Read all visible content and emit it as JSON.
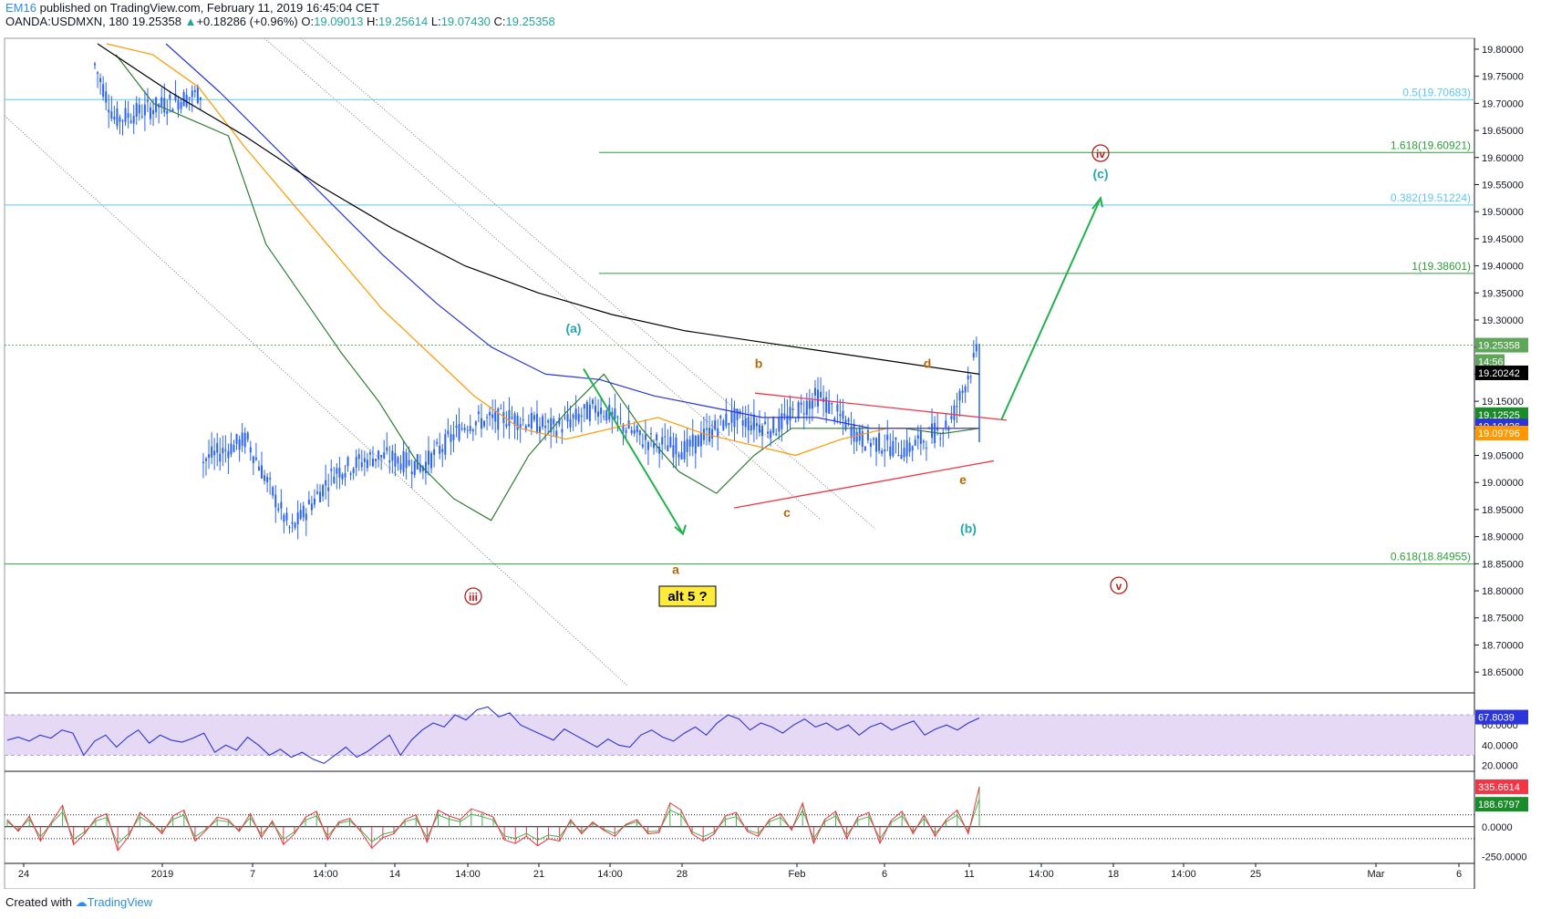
{
  "header": {
    "author": "EM16",
    "published": "published on TradingView.com, February 11, 2019 16:45:04 CET",
    "symbol": "OANDA:USDMXN, 180",
    "last": "19.25358",
    "change": "+0.18286 (+0.96%)",
    "o_label": "O:",
    "o_value": "19.09013",
    "h_label": "H:",
    "h_value": "19.25614",
    "l_label": "L:",
    "l_value": "19.07430",
    "c_label": "C:",
    "c_value": "19.25358"
  },
  "footer": {
    "created_with": "Created with",
    "brand": "TradingView"
  },
  "colors": {
    "up_candle": "#2962ff",
    "ema_fast": "#2e7d32",
    "ema_mid": "#ff9800",
    "ema_slow": "#2b35d8",
    "ema_long": "#000000",
    "fib_blue": "#5ec6f5",
    "fib_green": "#2e9e3a",
    "triangle": "#f23645",
    "wave_teal": "#26a6b0",
    "wave_brown": "#b8690a",
    "wave_red": "#b71c1c",
    "rsi_line": "#2b35d8",
    "rsi_band": "#e6d9f5"
  },
  "chart_data": [
    {
      "type": "candlestick",
      "title": "OANDA:USDMXN, 180",
      "ylim": [
        18.625,
        19.81
      ],
      "y_ticks": [
        "19.80000",
        "19.75000",
        "19.70000",
        "19.65000",
        "19.60000",
        "19.55000",
        "19.50000",
        "19.45000",
        "19.40000",
        "19.35000",
        "19.30000",
        "19.25000",
        "19.20000",
        "19.15000",
        "19.10000",
        "19.05000",
        "19.00000",
        "18.95000",
        "18.90000",
        "18.85000",
        "18.80000",
        "18.75000",
        "18.70000",
        "18.65000"
      ],
      "x_ticks": [
        "24",
        "2019",
        "7",
        "14:00",
        "14",
        "14:00",
        "21",
        "14:00",
        "28",
        "Feb",
        "6",
        "11",
        "14:00",
        "18",
        "14:00",
        "25",
        "Mar",
        "6"
      ],
      "price_path": [
        {
          "x": "Dec 27 12:00",
          "y": 19.78
        },
        {
          "x": "Dec 28",
          "y": 19.67
        },
        {
          "x": "Dec 30",
          "y": 19.72
        },
        {
          "x": "Jan 2",
          "y": 19.65
        },
        {
          "x": "Jan 4",
          "y": 19.63
        },
        {
          "x": "Jan 7",
          "y": 19.62
        },
        {
          "x": "Jan 8",
          "y": 19.47
        },
        {
          "x": "Jan 9",
          "y": 19.4
        },
        {
          "x": "Jan 10",
          "y": 19.33
        },
        {
          "x": "Jan 11",
          "y": 19.23
        },
        {
          "x": "Jan 12",
          "y": 19.2
        },
        {
          "x": "Jan 13",
          "y": 19.12
        },
        {
          "x": "Jan 14",
          "y": 19.02
        },
        {
          "x": "Jan 15",
          "y": 19.0
        },
        {
          "x": "Jan 16",
          "y": 18.9
        },
        {
          "x": "Jan 17",
          "y": 19.05
        },
        {
          "x": "Jan 18",
          "y": 19.0
        },
        {
          "x": "Jan 19",
          "y": 19.1
        },
        {
          "x": "Jan 21",
          "y": 19.17
        },
        {
          "x": "Jan 22",
          "y": 19.23
        },
        {
          "x": "Jan 23",
          "y": 19.17
        },
        {
          "x": "Jan 24",
          "y": 19.1
        },
        {
          "x": "Jan 25",
          "y": 19.04
        },
        {
          "x": "Jan 26",
          "y": 19.08
        },
        {
          "x": "Jan 27",
          "y": 18.91
        },
        {
          "x": "Jan 28",
          "y": 19.02
        },
        {
          "x": "Jan 29",
          "y": 19.05
        },
        {
          "x": "Jan 30",
          "y": 19.03
        },
        {
          "x": "Jan 31",
          "y": 19.11
        },
        {
          "x": "Feb 1",
          "y": 19.12
        },
        {
          "x": "Feb 2",
          "y": 19.1
        },
        {
          "x": "Feb 3",
          "y": 19.14
        },
        {
          "x": "Feb 4",
          "y": 19.08
        },
        {
          "x": "Feb 5",
          "y": 19.06
        },
        {
          "x": "Feb 6",
          "y": 19.12
        },
        {
          "x": "Feb 7",
          "y": 19.1
        },
        {
          "x": "Feb 8",
          "y": 19.16
        },
        {
          "x": "Feb 9",
          "y": 19.08
        },
        {
          "x": "Feb 10",
          "y": 19.06
        },
        {
          "x": "Feb 11",
          "y": 19.11
        },
        {
          "x": "Feb 11 16:00",
          "y": 19.25
        }
      ],
      "series": [
        {
          "name": "EMA fast",
          "values": [
            19.79,
            19.7,
            19.67,
            19.64,
            19.44,
            19.34,
            19.24,
            19.15,
            19.04,
            18.97,
            18.93,
            19.05,
            19.13,
            19.2,
            19.1,
            19.02,
            18.98,
            19.05,
            19.1,
            19.1,
            19.1,
            19.1,
            19.09,
            19.1
          ]
        },
        {
          "name": "EMA mid",
          "values": [
            19.81,
            19.79,
            19.73,
            19.62,
            19.52,
            19.42,
            19.32,
            19.24,
            19.16,
            19.1,
            19.08,
            19.1,
            19.12,
            19.09,
            19.07,
            19.05,
            19.08,
            19.1,
            19.1,
            19.1
          ]
        },
        {
          "name": "EMA slow",
          "values": [
            19.81,
            19.72,
            19.62,
            19.52,
            19.42,
            19.33,
            19.25,
            19.2,
            19.19,
            19.16,
            19.14,
            19.12,
            19.12,
            19.1,
            19.1,
            19.1
          ]
        },
        {
          "name": "EMA long",
          "values": [
            19.81,
            19.72,
            19.64,
            19.55,
            19.47,
            19.4,
            19.35,
            19.31,
            19.28,
            19.26,
            19.24,
            19.22,
            19.2
          ]
        }
      ],
      "price_labels": [
        {
          "value": "19.25358",
          "color": "#5fa55a"
        },
        {
          "value": "14:56",
          "color": "#5fa55a"
        },
        {
          "value": "19.20242",
          "color": "#000000"
        },
        {
          "value": "19.12525",
          "color": "#1b8a2a"
        },
        {
          "value": "19.10426",
          "color": "#2b35d8"
        },
        {
          "value": "19.09796",
          "color": "#ff9800"
        }
      ],
      "fib_levels": [
        {
          "label": "0.5(19.70683)",
          "value": 19.70683,
          "color": "blue"
        },
        {
          "label": "1.618(19.60921)",
          "value": 19.60921,
          "color": "green"
        },
        {
          "label": "0.382(19.51224)",
          "value": 19.51224,
          "color": "blue"
        },
        {
          "label": "1(19.38601)",
          "value": 19.38601,
          "color": "green"
        },
        {
          "label": "0.618(18.84955)",
          "value": 18.84955,
          "color": "green"
        }
      ],
      "wave_labels": [
        {
          "text": "iii",
          "circled": true,
          "color": "red"
        },
        {
          "text": "(a)",
          "color": "teal"
        },
        {
          "text": "a",
          "color": "brown"
        },
        {
          "text": "b",
          "color": "brown"
        },
        {
          "text": "c",
          "color": "brown"
        },
        {
          "text": "d",
          "color": "brown"
        },
        {
          "text": "e",
          "color": "brown"
        },
        {
          "text": "(b)",
          "color": "teal"
        },
        {
          "text": "(c)",
          "color": "teal"
        },
        {
          "text": "iv",
          "circled": true,
          "color": "red"
        },
        {
          "text": "v",
          "circled": true,
          "color": "red"
        }
      ],
      "annotation": "alt 5 ?"
    },
    {
      "type": "line",
      "name": "RSI",
      "ylim": [
        15,
        90
      ],
      "band": [
        70,
        30
      ],
      "y_ticks": [
        "60.0000",
        "40.0000",
        "20.0000"
      ],
      "last_label": "67.8039",
      "values": [
        45,
        48,
        44,
        50,
        47,
        55,
        52,
        30,
        44,
        50,
        38,
        48,
        55,
        42,
        50,
        45,
        43,
        47,
        52,
        33,
        40,
        35,
        48,
        40,
        30,
        36,
        28,
        33,
        26,
        22,
        30,
        38,
        28,
        34,
        42,
        50,
        30,
        45,
        55,
        62,
        58,
        70,
        65,
        75,
        78,
        68,
        72,
        60,
        55,
        50,
        45,
        56,
        50,
        44,
        38,
        46,
        40,
        38,
        50,
        55,
        48,
        44,
        52,
        58,
        50,
        62,
        70,
        66,
        55,
        62,
        58,
        52,
        60,
        66,
        58,
        62,
        55,
        60,
        50,
        58,
        62,
        55,
        60,
        64,
        50,
        56,
        60,
        55,
        62,
        67
      ]
    },
    {
      "type": "line",
      "name": "CCI / oscillator",
      "ylim": [
        -300,
        450
      ],
      "y_ticks": [
        "0.0000",
        "-250.0000"
      ],
      "levels": [
        100,
        -100
      ],
      "last_labels": [
        "335.6614",
        "188.6797"
      ],
      "values": [
        60,
        -40,
        90,
        -120,
        40,
        180,
        -150,
        -60,
        70,
        110,
        -200,
        -80,
        120,
        40,
        -60,
        90,
        140,
        -120,
        -30,
        80,
        60,
        -40,
        110,
        -90,
        50,
        -150,
        -60,
        80,
        130,
        -110,
        40,
        70,
        -40,
        -180,
        -90,
        -60,
        60,
        100,
        -130,
        140,
        90,
        60,
        150,
        120,
        80,
        -110,
        -140,
        -80,
        -160,
        -100,
        -120,
        60,
        -60,
        40,
        -30,
        -80,
        20,
        60,
        -60,
        -50,
        200,
        140,
        -60,
        -120,
        -60,
        90,
        120,
        -40,
        -80,
        60,
        110,
        -30,
        200,
        -140,
        60,
        130,
        -100,
        80,
        120,
        -140,
        50,
        130,
        -60,
        100,
        -80,
        60,
        140,
        -60,
        335
      ]
    }
  ]
}
